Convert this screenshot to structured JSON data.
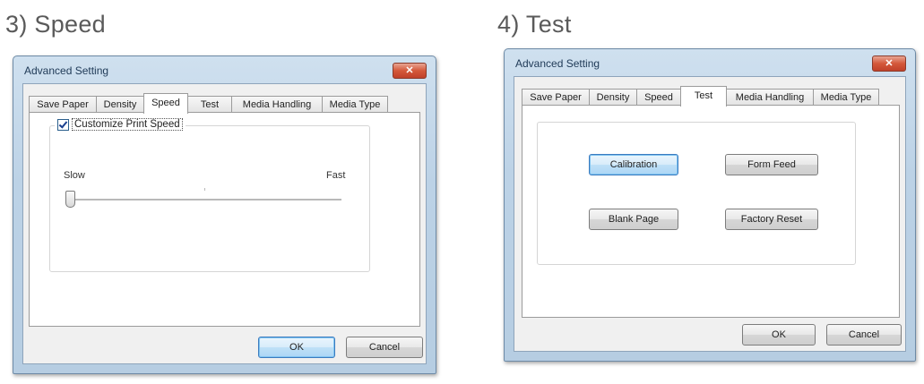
{
  "left": {
    "heading": "3) Speed",
    "dialog": {
      "title": "Advanced Setting",
      "close_glyph": "✕",
      "tabs": [
        {
          "label": "Save Paper"
        },
        {
          "label": "Density"
        },
        {
          "label": "Speed"
        },
        {
          "label": "Test"
        },
        {
          "label": "Media Handling"
        },
        {
          "label": "Media Type"
        }
      ],
      "active_tab": "Speed",
      "customize_label": "Customize Print Speed",
      "customize_checked": true,
      "slider_min_label": "Slow",
      "slider_max_label": "Fast",
      "slider_value_fraction": 0.0,
      "ok_label": "OK",
      "cancel_label": "Cancel"
    }
  },
  "right": {
    "heading": "4) Test",
    "dialog": {
      "title": "Advanced Setting",
      "close_glyph": "✕",
      "tabs": [
        {
          "label": "Save Paper"
        },
        {
          "label": "Density"
        },
        {
          "label": "Speed"
        },
        {
          "label": "Test"
        },
        {
          "label": "Media Handling"
        },
        {
          "label": "Media Type"
        }
      ],
      "active_tab": "Test",
      "calibration_label": "Calibration",
      "form_feed_label": "Form Feed",
      "blank_page_label": "Blank Page",
      "factory_reset_label": "Factory Reset",
      "ok_label": "OK",
      "cancel_label": "Cancel"
    }
  }
}
